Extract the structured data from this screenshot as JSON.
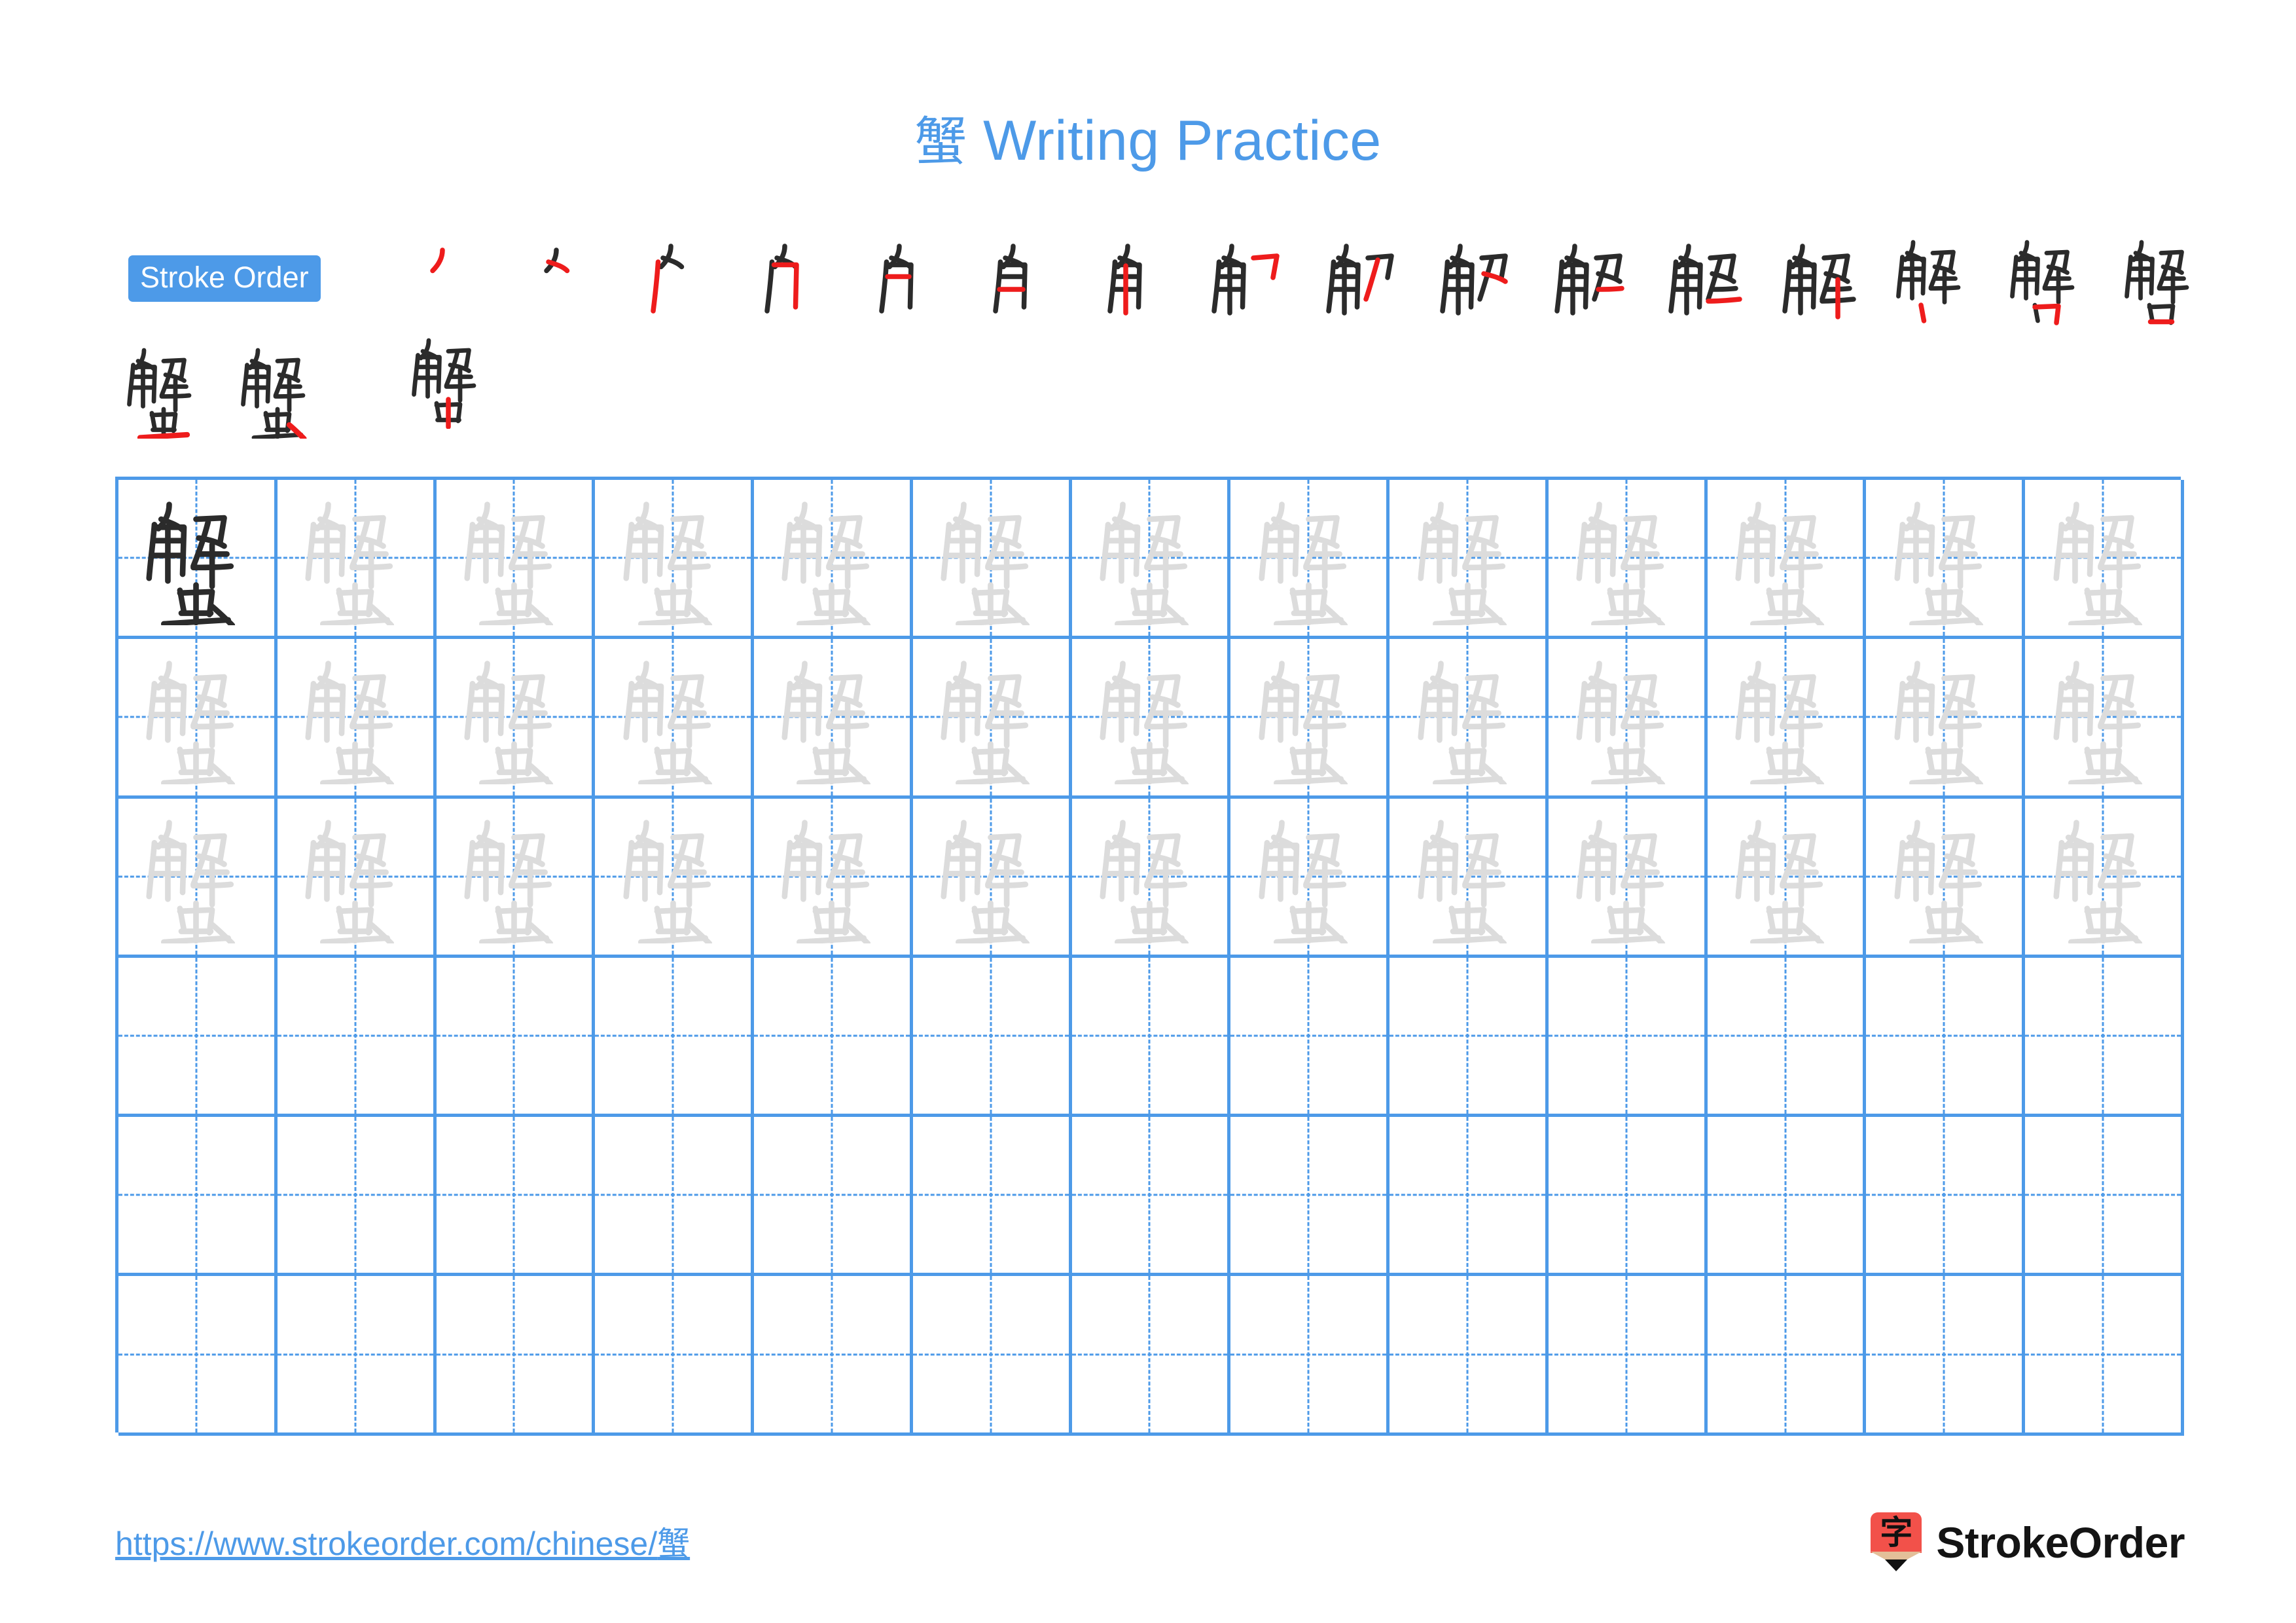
{
  "character": "蟹",
  "title": {
    "character": "蟹",
    "suffix": " Writing Practice",
    "full": "蟹 Writing Practice"
  },
  "stroke_order": {
    "badge_label": "Stroke Order",
    "total_strokes": 19,
    "steps": [
      {
        "index": 1,
        "partial": "丿"
      },
      {
        "index": 2,
        "partial": "⺈"
      },
      {
        "index": 3,
        "partial": "⺈丨"
      },
      {
        "index": 4,
        "partial": "⺈丨𠃌"
      },
      {
        "index": 5,
        "partial": "角(5)"
      },
      {
        "index": 6,
        "partial": "角(6)"
      },
      {
        "index": 7,
        "partial": "角"
      },
      {
        "index": 8,
        "partial": "角㇇"
      },
      {
        "index": 9,
        "partial": "角刀"
      },
      {
        "index": 10,
        "partial": "解(10)"
      },
      {
        "index": 11,
        "partial": "解(11)"
      },
      {
        "index": 12,
        "partial": "解(12)"
      },
      {
        "index": 13,
        "partial": "解"
      },
      {
        "index": 14,
        "partial": "解丶"
      },
      {
        "index": 15,
        "partial": "解冂"
      },
      {
        "index": 16,
        "partial": "解口"
      },
      {
        "index": 17,
        "partial": "解中"
      },
      {
        "index": 18,
        "partial": "蟹(18)"
      },
      {
        "index": 19,
        "partial": "蟹"
      }
    ],
    "row_counts": [
      17,
      2
    ]
  },
  "practice_grid": {
    "rows": 6,
    "columns": 13,
    "filled_rows": 3,
    "empty_rows": 3,
    "model_cell": {
      "row": 1,
      "column": 1,
      "shade": "dark"
    },
    "trace_shade": "light"
  },
  "footer": {
    "url": "https://www.strokeorder.com/chinese/蟹",
    "url_prefix": "https://www.strokeorder.com/chinese/",
    "url_character": "蟹",
    "brand_name": "StrokeOrder",
    "brand_mark_character": "字"
  },
  "colors": {
    "accent_blue": "#4d9ae8",
    "stroke_new_red": "#ee1c1c",
    "stroke_done_dark": "#2b2b2b",
    "trace_grey": "#dcdcdc",
    "brand_red": "#f2514a",
    "brand_wood": "#e3bf99",
    "text_black": "#141414",
    "background": "#ffffff"
  }
}
